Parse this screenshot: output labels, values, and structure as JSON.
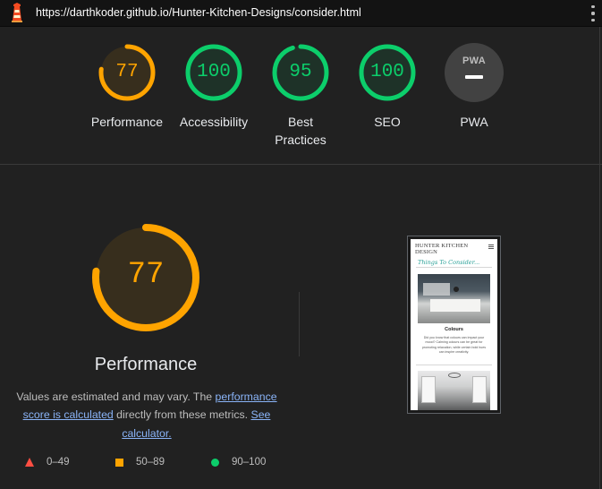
{
  "topbar": {
    "url": "https://darthkoder.github.io/Hunter-Kitchen-Designs/consider.html"
  },
  "gauges": [
    {
      "label": "Performance",
      "score": 77,
      "color": "#ffa400",
      "ring_fraction": 0.77
    },
    {
      "label": "Accessibility",
      "score": 100,
      "color": "#0cce6b",
      "ring_fraction": 1.0
    },
    {
      "label": "Best Practices",
      "score": 95,
      "color": "#0cce6b",
      "ring_fraction": 0.95
    },
    {
      "label": "SEO",
      "score": 100,
      "color": "#0cce6b",
      "ring_fraction": 1.0
    },
    {
      "label": "PWA",
      "badge_text": "PWA",
      "color": "#424242"
    }
  ],
  "performance": {
    "score": 77,
    "title": "Performance",
    "desc_prefix": "Values are estimated and may vary. The ",
    "desc_link1": "performance score is calculated",
    "desc_middle": " directly from these metrics. ",
    "desc_link2": "See calculator.",
    "color": "#ffa400"
  },
  "legend": {
    "fail": "0–49",
    "average": "50–89",
    "pass": "90–100"
  },
  "screenshot": {
    "brand": "Hunter Kitchen Design",
    "heading": "Things To Consider...",
    "section_title": "Colours",
    "section_text": "Did you know that colours can impact your mood? Calming colours can be great for promoting relaxation, while certain bold hues can inspire creativity."
  },
  "colors": {
    "background": "#212121",
    "topbar": "#131313",
    "link": "#8ab4f8",
    "fail": "#ff4e42",
    "average": "#ffa400",
    "pass": "#0cce6b"
  }
}
